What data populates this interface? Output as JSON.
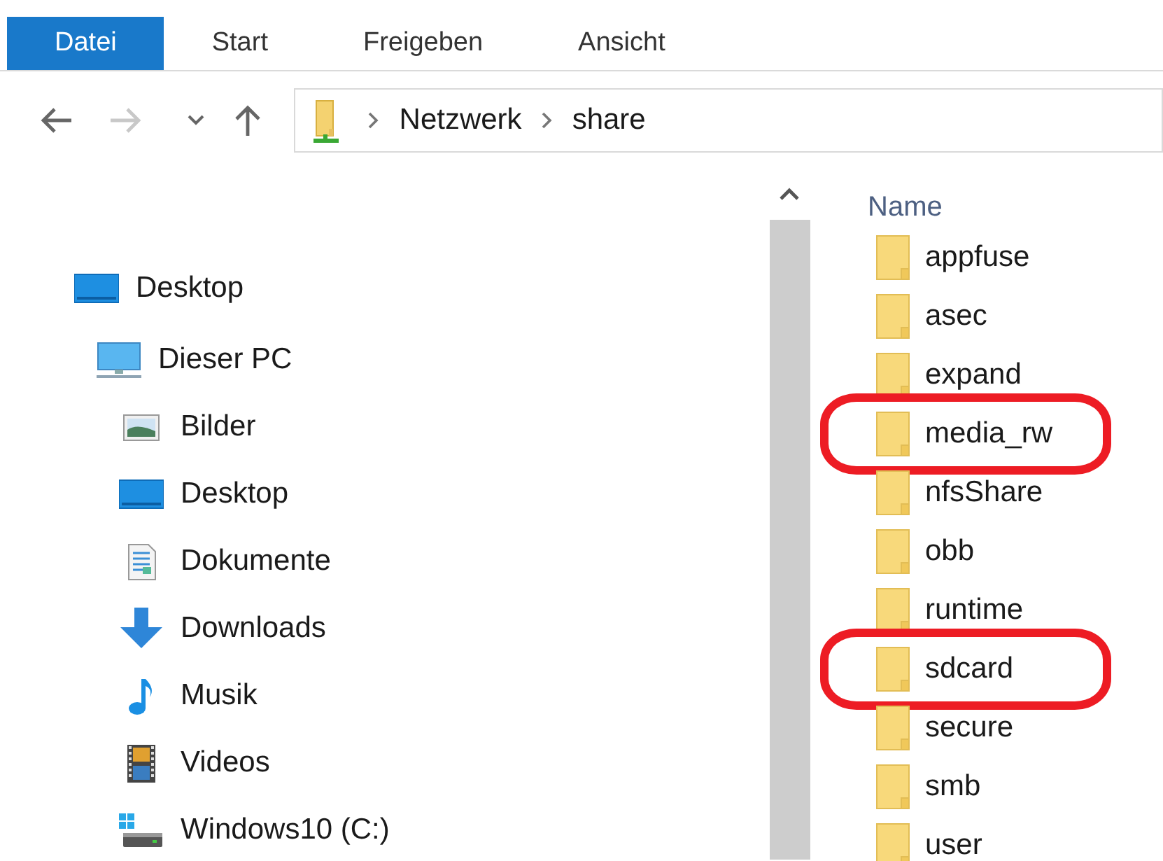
{
  "ribbon": {
    "tabs": [
      {
        "label": "Datei",
        "selected": true
      },
      {
        "label": "Start",
        "selected": false
      },
      {
        "label": "Freigeben",
        "selected": false
      },
      {
        "label": "Ansicht",
        "selected": false
      }
    ]
  },
  "address_bar": {
    "nav_buttons": [
      {
        "kind": "back",
        "disabled": false
      },
      {
        "kind": "forward",
        "disabled": true
      },
      {
        "kind": "recent",
        "disabled": false
      },
      {
        "kind": "up",
        "disabled": false
      }
    ],
    "breadcrumbs": [
      "Netzwerk",
      "share"
    ]
  },
  "navigation_pane": {
    "items": [
      {
        "label": "Desktop",
        "kind": "desktop",
        "children": [
          {
            "label": "Dieser PC",
            "kind": "pc",
            "children": [
              {
                "label": "Bilder",
                "kind": "pictures"
              },
              {
                "label": "Desktop",
                "kind": "desktop"
              },
              {
                "label": "Dokumente",
                "kind": "documents"
              },
              {
                "label": "Downloads",
                "kind": "downloads"
              },
              {
                "label": "Musik",
                "kind": "music"
              },
              {
                "label": "Videos",
                "kind": "videos"
              },
              {
                "label": "Windows10 (C:)",
                "kind": "drive"
              }
            ]
          }
        ]
      }
    ]
  },
  "file_list": {
    "column_header": "Name",
    "files": [
      {
        "name": "appfuse",
        "highlighted": false
      },
      {
        "name": "asec",
        "highlighted": false
      },
      {
        "name": "expand",
        "highlighted": false
      },
      {
        "name": "media_rw",
        "highlighted": true
      },
      {
        "name": "nfsShare",
        "highlighted": false
      },
      {
        "name": "obb",
        "highlighted": false
      },
      {
        "name": "runtime",
        "highlighted": false
      },
      {
        "name": "sdcard",
        "highlighted": true
      },
      {
        "name": "secure",
        "highlighted": false
      },
      {
        "name": "smb",
        "highlighted": false
      },
      {
        "name": "user",
        "highlighted": false
      }
    ]
  }
}
